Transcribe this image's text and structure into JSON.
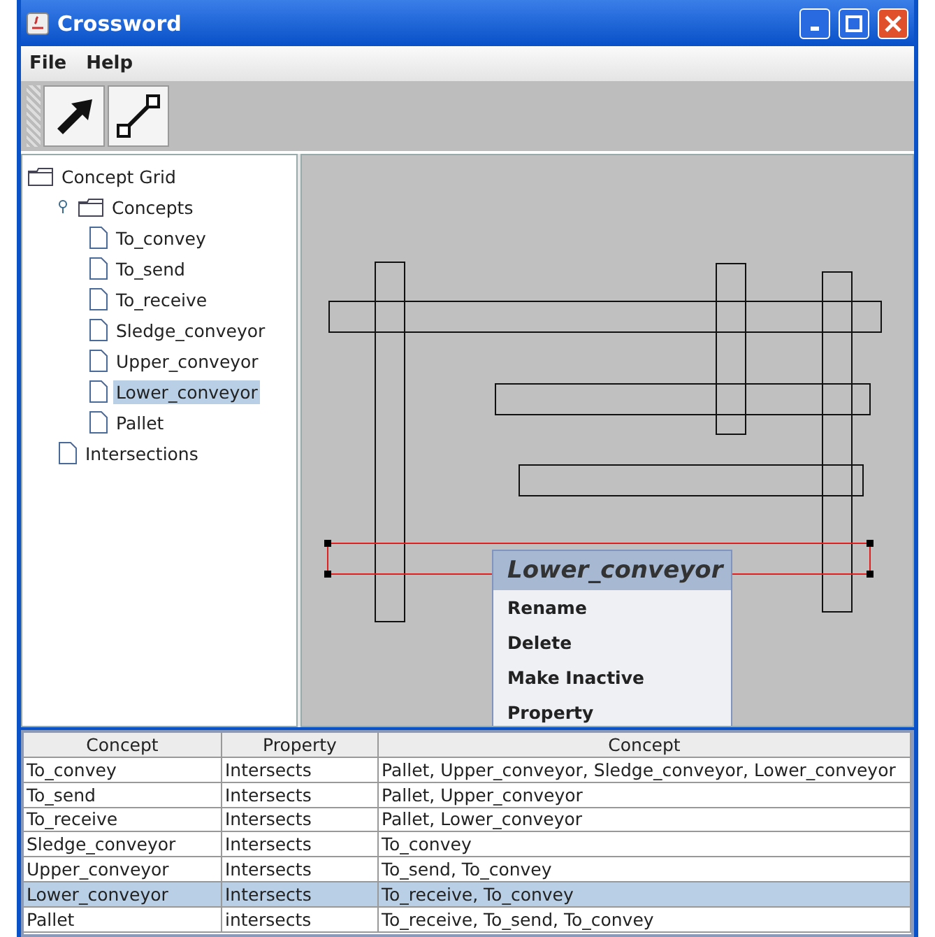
{
  "window": {
    "title": "Crossword"
  },
  "menu": [
    "File",
    "Help"
  ],
  "toolbar": [
    {
      "kind": "arrow"
    },
    {
      "kind": "connector"
    }
  ],
  "tree": {
    "label": "Concept Grid",
    "kind": "folder",
    "children": [
      {
        "label": "Concepts",
        "kind": "folder",
        "expanded": true,
        "children": [
          {
            "label": "To_convey",
            "kind": "file",
            "selected": false
          },
          {
            "label": "To_send",
            "kind": "file",
            "selected": false
          },
          {
            "label": "To_receive",
            "kind": "file",
            "selected": false
          },
          {
            "label": "Sledge_conveyor",
            "kind": "file",
            "selected": false
          },
          {
            "label": "Upper_conveyor",
            "kind": "file",
            "selected": false
          },
          {
            "label": "Lower_conveyor",
            "kind": "file",
            "selected": true
          },
          {
            "label": "Pallet",
            "kind": "file",
            "selected": false
          }
        ]
      },
      {
        "label": "Intersections",
        "kind": "file",
        "selected": false
      }
    ]
  },
  "canvas": {
    "slots": [
      {
        "kind": "horizontal",
        "selected": false
      },
      {
        "kind": "vertical",
        "selected": false
      },
      {
        "kind": "vertical",
        "selected": false
      },
      {
        "kind": "vertical",
        "selected": false
      },
      {
        "kind": "horizontal",
        "selected": false
      },
      {
        "kind": "horizontal",
        "selected": false
      },
      {
        "kind": "horizontal",
        "selected": true
      }
    ],
    "context_menu": {
      "title": "Lower_conveyor",
      "items": [
        "Rename",
        "Delete",
        "Make Inactive",
        "Property"
      ]
    }
  },
  "table": {
    "columns": [
      "Concept",
      "Property",
      "Concept"
    ],
    "rows": [
      {
        "cells": [
          "To_convey",
          "Intersects",
          "Pallet, Upper_conveyor, Sledge_conveyor, Lower_conveyor"
        ],
        "selected": false
      },
      {
        "cells": [
          "To_send",
          "Intersects",
          "Pallet, Upper_conveyor"
        ],
        "selected": false
      },
      {
        "cells": [
          "To_receive",
          "Intersects",
          "Pallet, Lower_conveyor"
        ],
        "selected": false
      },
      {
        "cells": [
          "Sledge_conveyor",
          "Intersects",
          "To_convey"
        ],
        "selected": false
      },
      {
        "cells": [
          "Upper_conveyor",
          "Intersects",
          "To_send, To_convey"
        ],
        "selected": false
      },
      {
        "cells": [
          "Lower_conveyor",
          "Intersects",
          "To_receive, To_convey"
        ],
        "selected": true
      },
      {
        "cells": [
          "Pallet",
          "intersects",
          "To_receive, To_send, To_convey"
        ],
        "selected": false
      }
    ]
  }
}
